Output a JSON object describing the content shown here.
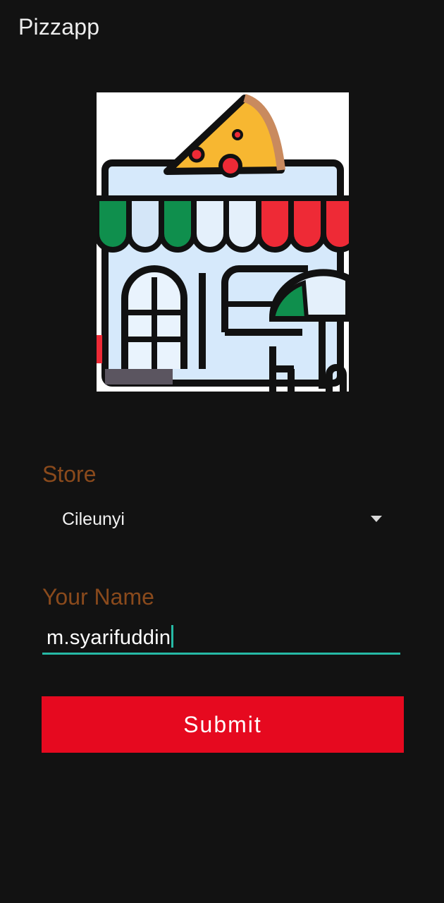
{
  "app": {
    "title": "Pizzapp"
  },
  "logo": {
    "icon": "pizza-store-icon"
  },
  "form": {
    "store_label": "Store",
    "store_selected": "Cileunyi",
    "name_label": "Your Name",
    "name_value": "m.syarifuddin",
    "submit_label": "Submit"
  },
  "colors": {
    "background": "#121212",
    "label": "#8a4a1c",
    "accent": "#26b9a5",
    "submit": "#e6091f"
  }
}
